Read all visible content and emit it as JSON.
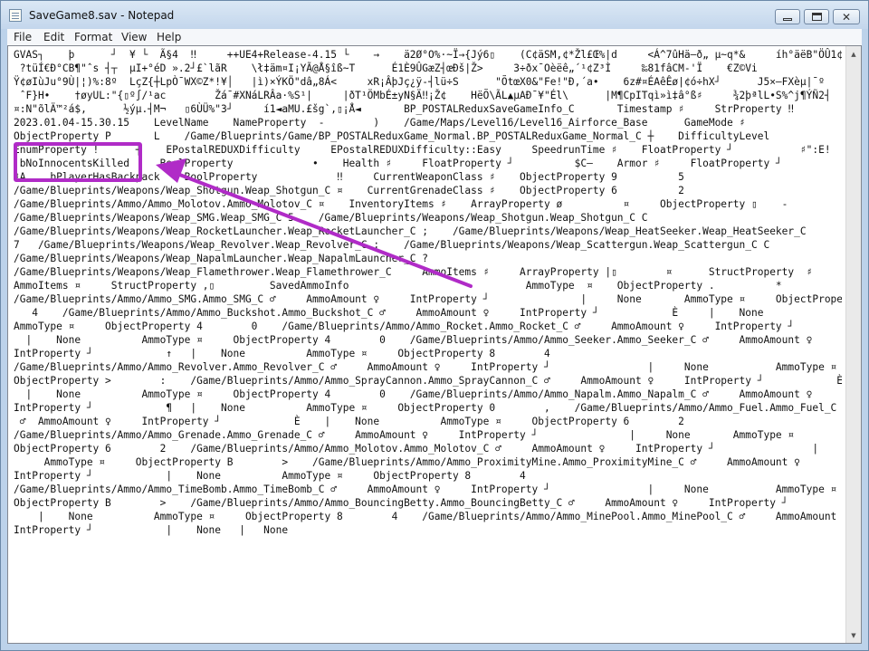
{
  "window": {
    "title": "SaveGame8.sav - Notepad",
    "icon": "notepad-icon",
    "controls": [
      "minimize-icon",
      "maximize-icon",
      "close-icon"
    ],
    "close_glyph": "✕"
  },
  "menu": [
    "File",
    "Edit",
    "Format",
    "View",
    "Help"
  ],
  "scrollbar": {
    "up_glyph": "▲",
    "down_glyph": "▼"
  },
  "annotation": {
    "highlighted_text": "bNoInnocentsKilled",
    "color": "#b02bc7"
  },
  "content_lines": [
    "GVAS┐    þ      ┘  ¥ └  Ã§4  ‼     ++UE4+Release-4.15 └    →    ä2Ø°O%·~Ï→{Jý6▯    (C¢äSM,¢*Žl£Œ%|d     <Á^7ûHä—ð„ µ~q*&     íh°äëB\"ÖÛ1¢A»F.♯",
    " ?tüÍ€Ð°CB¶\"ˆs ┤┬  µI+°éD ».2┘£`lãR    \\ł‡äm¤I¡YÃ@Å§îß~T      É1È9ÛGæZ┤œÐš|Ž>     3÷ðx¯Oèëê„´¹¢Z³Ì     ‰81fâCM-'Ï    €Z©Vi",
    "Ÿ¢øIùJu°9Ù|¦)%:8º  LçZ{┼LpÒ¯WX©Z*!¥│   |ì)×ÝKÖ\"dâ„8Á<     xR¡ÂþJç¿ÿ-┤lü÷S      \"ÕtœX0&\"Fe!\"Ð,´a•    6z#¤ÉAêÊø|¢ó÷hX┘      J5×—FXèµ|¯º",
    " ˆF}H•    †øyUL:\"{▯º∫/¹ac        Žá¯#XNáLRÂa·%S¹|     |ðT¹ÖMbÉ±yN§Ä‼¡Ž¢    HëÕ\\ÃL▲µAÐ¯¥\"Él\\      |M¶CpITqì»ì‡â°ß♯     ¾2þªlL•S%^j¶ÝÑ2┤      ê·b",
    "¤:N\"õlÄ™²á$,      ½ýµ.┤M¬   ▯6ÙÜ%\"3┘     í1◄aMU.£šg`‚▯¡Å◄       BP_POSTALReduxSaveGameInfo_C       Timestamp ♯     StrProperty ‼           ¶",
    "2023.01.04-15.30.15    LevelName    NameProperty  -        )    /Game/Maps/Level16/Level16_Airforce_Base      GameMode ♯",
    "ObjectProperty P       L    /Game/Blueprints/Game/BP_POSTALReduxGame_Normal.BP_POSTALReduxGame_Normal_C ┼    DifficultyLevel",
    "EnumProperty !      ┤    EPostalREDUXDifficulty     EPostalREDUXDifficulty::Easy     SpeedrunTime ♯    FloatProperty ┘           ♯\":E!",
    " bNoInnocentsKilled     BoolProperty             •    Health ♯     FloatProperty ┘          $C—    Armor ♯     FloatProperty ┘",
    "♯A    bPlayerHasBackpack    BoolProperty             ‼     CurrentWeaponClass ♯    ObjectProperty 9          5",
    "/Game/Blueprints/Weapons/Weap_Shotgun.Weap_Shotgun_C ¤    CurrentGrenadeClass ♯    ObjectProperty 6          2",
    "/Game/Blueprints/Ammo/Ammo_Molotov.Ammo_Molotov_C ¤    InventoryItems ♯    ArrayProperty ø          ¤     ObjectProperty ▯    -",
    "/Game/Blueprints/Weapons/Weap_SMG.Weap_SMG_C 5    /Game/Blueprints/Weapons/Weap_Shotgun.Weap_Shotgun_C C",
    "/Game/Blueprints/Weapons/Weap_RocketLauncher.Weap_RocketLauncher_C ;    /Game/Blueprints/Weapons/Weap_HeatSeeker.Weap_HeatSeeker_C",
    "7   /Game/Blueprints/Weapons/Weap_Revolver.Weap_Revolver_C ;    /Game/Blueprints/Weapons/Weap_Scattergun.Weap_Scattergun_C C",
    "/Game/Blueprints/Weapons/Weap_NapalmLauncher.Weap_NapalmLauncher_C ?",
    "/Game/Blueprints/Weapons/Weap_Flamethrower.Weap_Flamethrower_C     AmmoItems ♯     ArrayProperty |▯        ¤      StructProperty  ♯",
    "AmmoItems ¤     StructProperty ,▯         SavedAmmoInfo                             AmmoType  ¤    ObjectProperty .          *",
    "/Game/Blueprints/Ammo/Ammo_SMG.Ammo_SMG_C ♂     AmmoAmount ♀     IntProperty ┘               |     None       AmmoType ¤     ObjectProperty 8",
    "   4    /Game/Blueprints/Ammo/Ammo_Buckshot.Ammo_Buckshot_C ♂     AmmoAmount ♀     IntProperty ┘            È     |    None",
    "AmmoType ¤     ObjectProperty 4        0    /Game/Blueprints/Ammo/Ammo_Rocket.Ammo_Rocket_C ♂     AmmoAmount ♀     IntProperty ┘            ↑",
    "  |    None          AmmoType ¤     ObjectProperty 4        0    /Game/Blueprints/Ammo/Ammo_Seeker.Ammo_Seeker_C ♂     AmmoAmount ♀",
    "IntProperty ┘            ↑   |    None          AmmoType ¤     ObjectProperty 8        4",
    "/Game/Blueprints/Ammo/Ammo_Revolver.Ammo_Revolver_C ♂     AmmoAmount ♀     IntProperty ┘                |     None           AmmoType ¤",
    "ObjectProperty >        :    /Game/Blueprints/Ammo/Ammo_SprayCannon.Ammo_SprayCannon_C ♂     AmmoAmount ♀     IntProperty ┘            È",
    "  |    None          AmmoType ¤     ObjectProperty 4        0    /Game/Blueprints/Ammo/Ammo_Napalm.Ammo_Napalm_C ♂     AmmoAmount ♀",
    "IntProperty ┘            ¶   |    None          AmmoType ¤     ObjectProperty 0        ,    /Game/Blueprints/Ammo/Ammo_Fuel.Ammo_Fuel_C",
    " ♂  AmmoAmount ♀     IntProperty ┘            È    |    None          AmmoType ¤     ObjectProperty 6        2",
    "/Game/Blueprints/Ammo/Ammo_Grenade.Ammo_Grenade_C ♂     AmmoAmount ♀     IntProperty ┘               |     None       AmmoType ¤",
    "ObjectProperty 6        2    /Game/Blueprints/Ammo/Ammo_Molotov.Ammo_Molotov_C ♂     AmmoAmount ♀     IntProperty ┘                |    None",
    "     AmmoType ¤     ObjectProperty B        >    /Game/Blueprints/Ammo/Ammo_ProximityMine.Ammo_ProximityMine_C ♂     AmmoAmount ♀",
    "IntProperty ┘            |    None          AmmoType ¤     ObjectProperty 8        4",
    "/Game/Blueprints/Ammo/Ammo_TimeBomb.Ammo_TimeBomb_C ♂     AmmoAmount ♀     IntProperty ┘                |     None           AmmoType ¤",
    "ObjectProperty B        >    /Game/Blueprints/Ammo/Ammo_BouncingBetty.Ammo_BouncingBetty_C ♂     AmmoAmount ♀     IntProperty ┘",
    "    |    None          AmmoType ¤     ObjectProperty 8        4    /Game/Blueprints/Ammo/Ammo_MinePool.Ammo_MinePool_C ♂     AmmoAmount ♀",
    "IntProperty ┘            |    None   |   None"
  ]
}
